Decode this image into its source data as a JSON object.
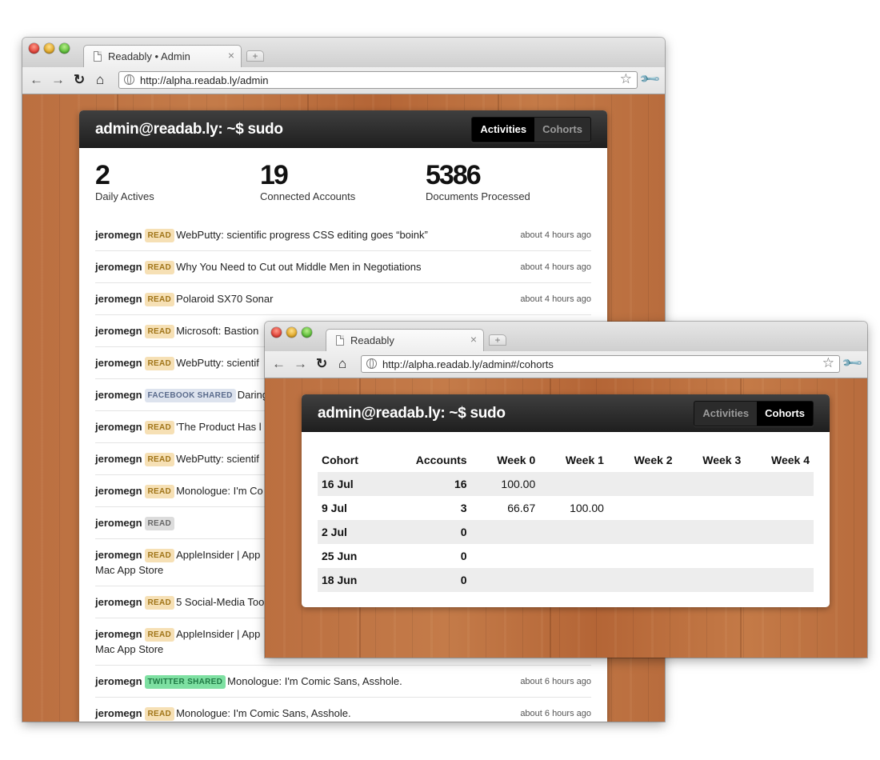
{
  "window_back": {
    "tab_title": "Readably • Admin",
    "url": "http://alpha.readab.ly/admin",
    "header_title": "admin@readab.ly: ~$ sudo",
    "nav": [
      "Activities",
      "Cohorts"
    ],
    "active_nav": "Activities",
    "stats": [
      {
        "value": "2",
        "label": "Daily Actives"
      },
      {
        "value": "19",
        "label": "Connected Accounts"
      },
      {
        "value": "5386",
        "label": "Documents Processed"
      }
    ],
    "feed": [
      {
        "user": "jeromegn",
        "badge": "READ",
        "type": "read",
        "title": "WebPutty: scientific progress CSS editing goes “boink”",
        "time": "about 4 hours ago"
      },
      {
        "user": "jeromegn",
        "badge": "READ",
        "type": "read",
        "title": "Why You Need to Cut out Middle Men in Negotiations",
        "time": "about 4 hours ago"
      },
      {
        "user": "jeromegn",
        "badge": "READ",
        "type": "read",
        "title": "Polaroid SX70 Sonar",
        "time": "about 4 hours ago"
      },
      {
        "user": "jeromegn",
        "badge": "READ",
        "type": "read",
        "title": "Microsoft: Bastion",
        "time": ""
      },
      {
        "user": "jeromegn",
        "badge": "READ",
        "type": "read",
        "title": "WebPutty: scientif",
        "time": ""
      },
      {
        "user": "jeromegn",
        "badge": "FACEBOOK SHARED",
        "type": "fb",
        "title": "Daring",
        "time": ""
      },
      {
        "user": "jeromegn",
        "badge": "READ",
        "type": "read",
        "title": "'The Product Has l",
        "time": ""
      },
      {
        "user": "jeromegn",
        "badge": "READ",
        "type": "read",
        "title": "WebPutty: scientif",
        "time": ""
      },
      {
        "user": "jeromegn",
        "badge": "READ",
        "type": "read",
        "title": "Monologue: I'm Co",
        "time": ""
      },
      {
        "user": "jeromegn",
        "badge": "READ",
        "type": "plain",
        "title": "",
        "time": ""
      },
      {
        "user": "jeromegn",
        "badge": "READ",
        "type": "read",
        "title": "AppleInsider | App",
        "title2": "Mac App Store",
        "time": ""
      },
      {
        "user": "jeromegn",
        "badge": "READ",
        "type": "read",
        "title": "5 Social-Media Too",
        "time": ""
      },
      {
        "user": "jeromegn",
        "badge": "READ",
        "type": "read",
        "title": "AppleInsider | App",
        "title2": "Mac App Store",
        "time": ""
      },
      {
        "user": "jeromegn",
        "badge": "TWITTER SHARED",
        "type": "tw",
        "title": "Monologue: I'm Comic Sans, Asshole.",
        "time": "about 6 hours ago"
      },
      {
        "user": "jeromegn",
        "badge": "READ",
        "type": "read",
        "title": "Monologue: I'm Comic Sans, Asshole.",
        "time": "about 6 hours ago"
      }
    ]
  },
  "window_front": {
    "tab_title": "Readably",
    "url": "http://alpha.readab.ly/admin#/cohorts",
    "header_title": "admin@readab.ly: ~$ sudo",
    "nav": [
      "Activities",
      "Cohorts"
    ],
    "active_nav": "Cohorts",
    "columns": [
      "Cohort",
      "Accounts",
      "Week 0",
      "Week 1",
      "Week 2",
      "Week 3",
      "Week 4"
    ],
    "rows": [
      [
        "16 Jul",
        "16",
        "100.00",
        "",
        "",
        "",
        ""
      ],
      [
        "9 Jul",
        "3",
        "66.67",
        "100.00",
        "",
        "",
        ""
      ],
      [
        "2 Jul",
        "0",
        "",
        "",
        "",
        "",
        ""
      ],
      [
        "25 Jun",
        "0",
        "",
        "",
        "",
        "",
        ""
      ],
      [
        "18 Jun",
        "0",
        "",
        "",
        "",
        "",
        ""
      ]
    ]
  },
  "chrome": {
    "new_tab": "+",
    "close_tab": "×",
    "back": "←",
    "forward": "→",
    "reload": "↻",
    "home": "⌂",
    "bookmark_star": "☆",
    "menu": "🔧"
  }
}
